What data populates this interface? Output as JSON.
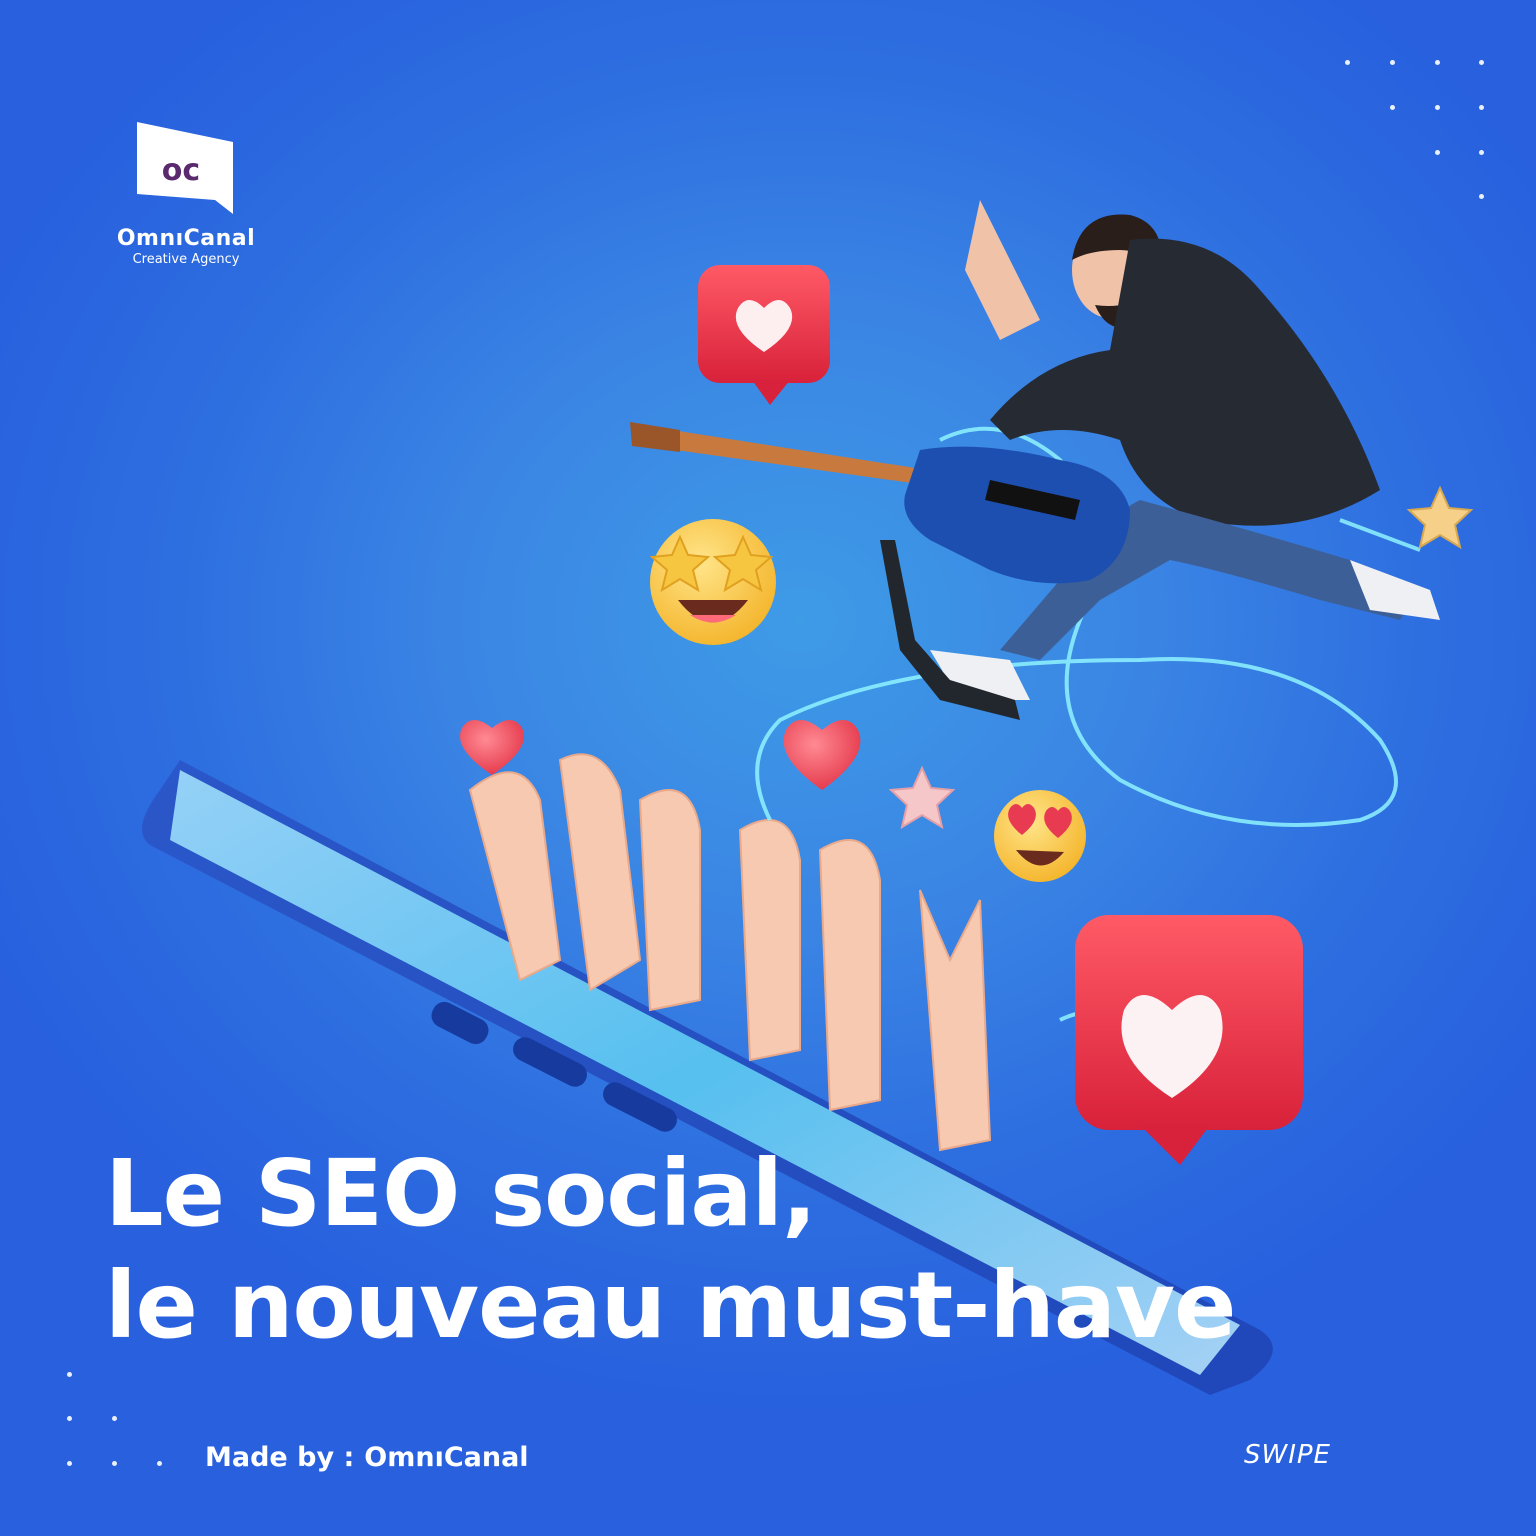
{
  "brand": {
    "logo_mark": "oc",
    "name": "OmnıCanal",
    "tagline": "Creative Agency"
  },
  "headline": {
    "line1": "Le SEO social,",
    "line2": "le nouveau must-have"
  },
  "footer": {
    "made_by_label": "Made by :",
    "made_by_brand": "OmnıCanal",
    "swipe": "SWIPE"
  },
  "colors": {
    "background": "#2d6ee0",
    "logo_purple": "#5b2a6e",
    "like_red": "#e8384a",
    "neon": "#8ff3ff"
  },
  "icons": [
    "heart-like-bubble-icon",
    "star-struck-emoji-icon",
    "heart-eyes-emoji-icon",
    "heart-icon",
    "star-icon"
  ]
}
